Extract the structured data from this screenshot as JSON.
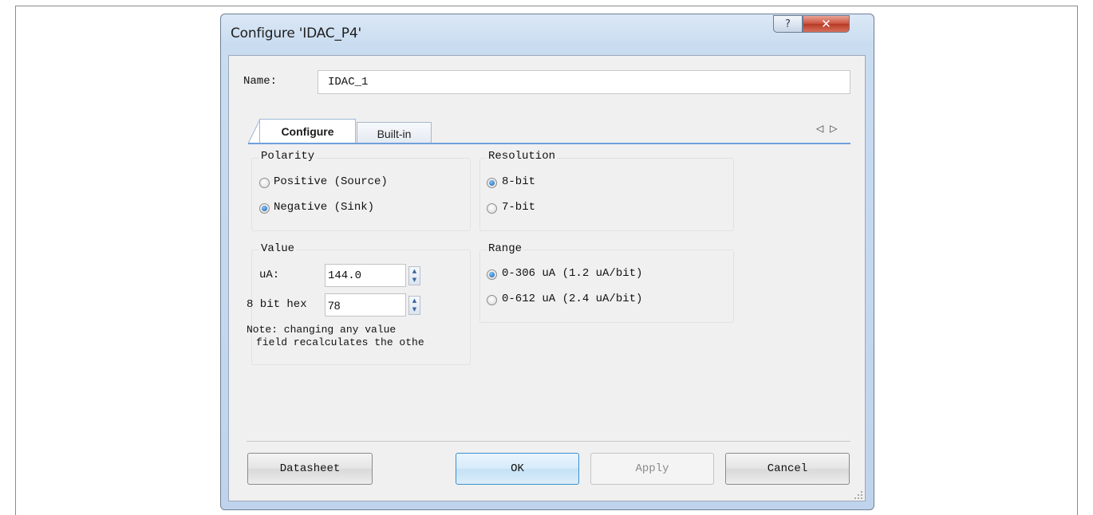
{
  "dialog": {
    "title": "Configure 'IDAC_P4'",
    "help_symbol": "?",
    "close_symbol": "✕"
  },
  "name_field": {
    "label": "Name:",
    "value": "IDAC_1"
  },
  "tabs": [
    {
      "label": "Configure",
      "selected": true
    },
    {
      "label": "Built-in",
      "selected": false
    }
  ],
  "tab_scroll": {
    "left": "◁",
    "right": "▷"
  },
  "polarity": {
    "title": "Polarity",
    "options": [
      {
        "label": "Positive (Source)",
        "checked": false
      },
      {
        "label": "Negative (Sink)",
        "checked": true
      }
    ]
  },
  "resolution": {
    "title": "Resolution",
    "options": [
      {
        "label": "8-bit",
        "checked": true
      },
      {
        "label": "7-bit",
        "checked": false
      }
    ]
  },
  "value": {
    "title": "Value",
    "ua_label": "uA:",
    "ua_value": "144.0",
    "hex_label": "8 bit hex",
    "hex_value": "78",
    "note_line1": "Note: changing any value",
    "note_line2": "field recalculates the othe"
  },
  "range": {
    "title": "Range",
    "options": [
      {
        "label": "0-306 uA (1.2 uA/bit)",
        "checked": true
      },
      {
        "label": "0-612 uA (2.4 uA/bit)",
        "checked": false
      }
    ]
  },
  "buttons": {
    "datasheet": "Datasheet",
    "ok": "OK",
    "apply": "Apply",
    "cancel": "Cancel"
  },
  "colors": {
    "accent": "#6fa0dc",
    "close_red": "#c9503c",
    "ok_border": "#3c90d0"
  }
}
